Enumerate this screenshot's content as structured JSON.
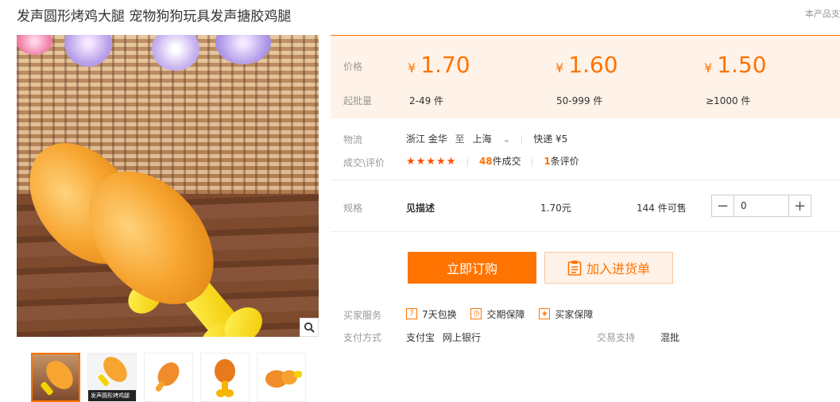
{
  "title": "发声圆形烤鸡大腿 宠物狗狗玩具发声搪胶鸡腿",
  "top_note": "本产品支",
  "gallery": {
    "zoom_icon": "magnifier-icon",
    "thumb_badge": "发声圆形烤鸡腿",
    "thumbnails": 5
  },
  "price_box": {
    "price_label": "价格",
    "min_qty_label": "起批量",
    "tiers": [
      {
        "price": "1.70",
        "qty": "2-49 件"
      },
      {
        "price": "1.60",
        "qty": "50-999 件"
      },
      {
        "price": "1.50",
        "qty": "≥1000 件"
      }
    ],
    "currency": "¥"
  },
  "logistics": {
    "label": "物流",
    "from": "浙江 金华",
    "to_word": "至",
    "to": "上海",
    "shipping": "快递 ¥5"
  },
  "rating": {
    "label": "成交\\评价",
    "stars": 5,
    "deals_count": "48",
    "deals_text": "件成交",
    "reviews_count": "1",
    "reviews_text": "条评价"
  },
  "spec": {
    "label": "规格",
    "name": "见描述",
    "price": "1.70元",
    "stock": "144 件可售",
    "quantity": "0",
    "minus": "−",
    "plus": "+"
  },
  "actions": {
    "buy_now": "立即订购",
    "add_to_cart": "加入进货单"
  },
  "services": {
    "label": "买家服务",
    "items": [
      "7天包换",
      "交期保障",
      "买家保障"
    ]
  },
  "payment": {
    "label": "支付方式",
    "methods": [
      "支付宝",
      "网上银行"
    ],
    "trade_label": "交易支持",
    "trade_value": "混批"
  },
  "colors": {
    "accent": "#ff7300",
    "price_bg": "#fff2e8"
  }
}
